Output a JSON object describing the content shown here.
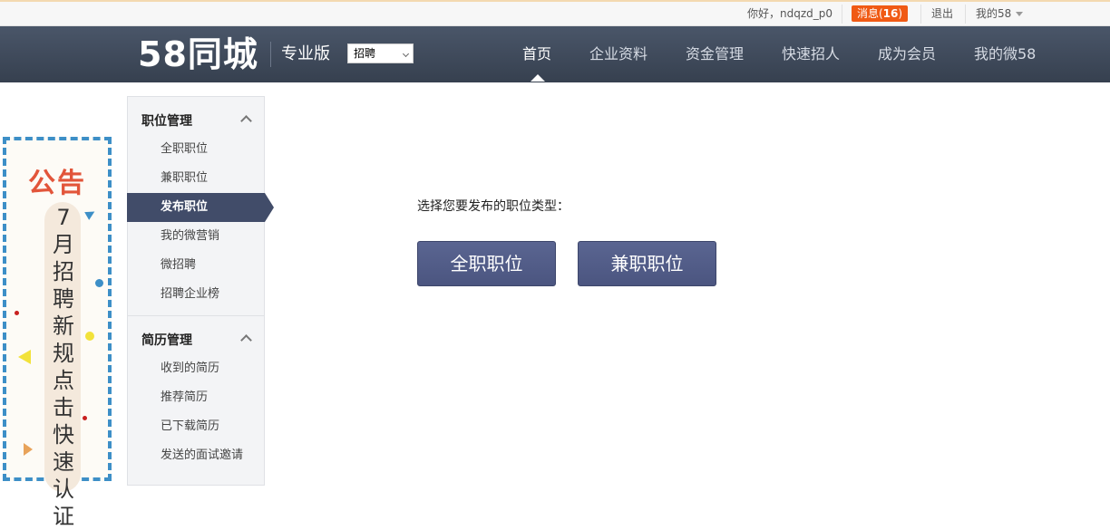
{
  "topbar": {
    "greeting": "你好，ndqzd_p0",
    "message_label": "消息(",
    "message_count": "16",
    "message_close": ")",
    "logout": "退出",
    "my58": "我的58"
  },
  "header": {
    "logo": "58同城",
    "edition": "专业版",
    "category_select": "招聘",
    "nav": [
      {
        "label": "首页"
      },
      {
        "label": "企业资料"
      },
      {
        "label": "资金管理"
      },
      {
        "label": "快速招人"
      },
      {
        "label": "成为会员"
      },
      {
        "label": "我的微58"
      }
    ]
  },
  "banner": {
    "title": "公告",
    "text": "7月招聘新规点击快速认证"
  },
  "sidebar": {
    "groups": [
      {
        "title": "职位管理",
        "items": [
          "全职职位",
          "兼职职位",
          "发布职位",
          "我的微营销",
          "微招聘",
          "招聘企业榜"
        ]
      },
      {
        "title": "简历管理",
        "items": [
          "收到的简历",
          "推荐简历",
          "已下载简历",
          "发送的面试邀请"
        ]
      }
    ]
  },
  "main": {
    "prompt": "选择您要发布的职位类型：",
    "buttons": {
      "fulltime": "全职职位",
      "parttime": "兼职职位"
    }
  },
  "colors": {
    "nav_bg": "#3f4a5c",
    "active_sidebar": "#414c69",
    "button": "#535e8a",
    "message_badge": "#f05a14",
    "banner_border": "#3d8fc7",
    "banner_title": "#e2553a"
  }
}
